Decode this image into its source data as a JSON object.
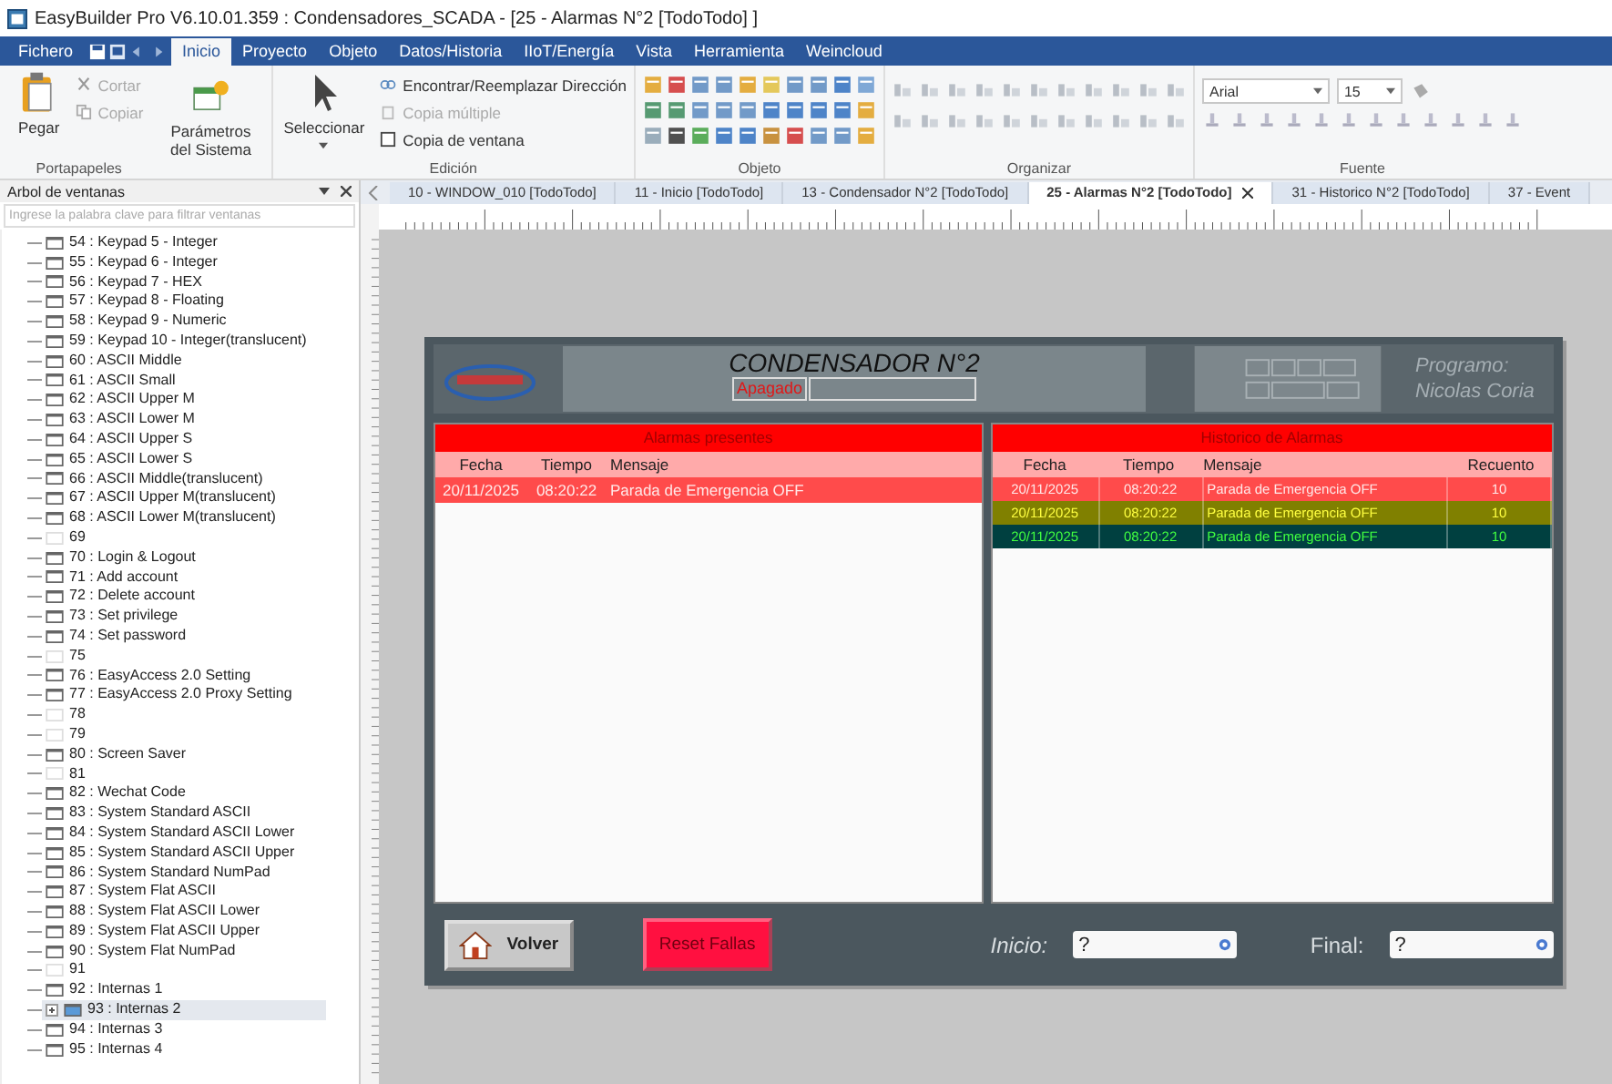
{
  "window": {
    "title": "EasyBuilder Pro V6.10.01.359 : Condensadores_SCADA - [25 - Alarmas N°2 [TodoTodo] ]"
  },
  "menu_tabs": [
    {
      "label": "Fichero",
      "selected": false
    },
    {
      "label": "Inicio",
      "selected": true
    },
    {
      "label": "Proyecto",
      "selected": false
    },
    {
      "label": "Objeto",
      "selected": false
    },
    {
      "label": "Datos/Historia",
      "selected": false
    },
    {
      "label": "IIoT/Energía",
      "selected": false
    },
    {
      "label": "Vista",
      "selected": false
    },
    {
      "label": "Herramienta",
      "selected": false
    },
    {
      "label": "Weincloud",
      "selected": false
    }
  ],
  "ribbon": {
    "clipboard": {
      "paste": "Pegar",
      "cut": {
        "label": "Cortar",
        "disabled": true
      },
      "copy": {
        "label": "Copiar",
        "disabled": true
      },
      "caption": "Portapapeles"
    },
    "system": {
      "label": "Parámetros del Sistema"
    },
    "edit": {
      "select": "Seleccionar",
      "find": {
        "label": "Encontrar/Reemplazar Dirección",
        "disabled": false
      },
      "multi_copy": {
        "label": "Copia múltiple",
        "disabled": true
      },
      "window_copy": {
        "label": "Copia de ventana",
        "disabled": false
      },
      "caption": "Edición"
    },
    "object": {
      "caption": "Objeto"
    },
    "arrange": {
      "caption": "Organizar"
    },
    "font": {
      "family": "Arial",
      "size": "15",
      "caption": "Fuente"
    }
  },
  "window_tree": {
    "title": "Arbol de ventanas",
    "search": {
      "placeholder": "Ingrese la palabra clave para filtrar ventanas"
    },
    "items": [
      {
        "label": "54 : Keypad 5 - Integer",
        "has_window": true,
        "selected": false,
        "has_children": false
      },
      {
        "label": "55 : Keypad 6 - Integer",
        "has_window": true,
        "selected": false,
        "has_children": false
      },
      {
        "label": "56 : Keypad 7 - HEX",
        "has_window": true,
        "selected": false,
        "has_children": false
      },
      {
        "label": "57 : Keypad 8 - Floating",
        "has_window": true,
        "selected": false,
        "has_children": false
      },
      {
        "label": "58 : Keypad 9 - Numeric",
        "has_window": true,
        "selected": false,
        "has_children": false
      },
      {
        "label": "59 : Keypad 10 - Integer(translucent)",
        "has_window": true,
        "selected": false,
        "has_children": false
      },
      {
        "label": "60 : ASCII Middle",
        "has_window": true,
        "selected": false,
        "has_children": false
      },
      {
        "label": "61 : ASCII Small",
        "has_window": true,
        "selected": false,
        "has_children": false
      },
      {
        "label": "62 : ASCII Upper M",
        "has_window": true,
        "selected": false,
        "has_children": false
      },
      {
        "label": "63 : ASCII Lower M",
        "has_window": true,
        "selected": false,
        "has_children": false
      },
      {
        "label": "64 : ASCII Upper S",
        "has_window": true,
        "selected": false,
        "has_children": false
      },
      {
        "label": "65 : ASCII Lower S",
        "has_window": true,
        "selected": false,
        "has_children": false
      },
      {
        "label": "66 : ASCII Middle(translucent)",
        "has_window": true,
        "selected": false,
        "has_children": false
      },
      {
        "label": "67 : ASCII Upper M(translucent)",
        "has_window": true,
        "selected": false,
        "has_children": false
      },
      {
        "label": "68 : ASCII Lower M(translucent)",
        "has_window": true,
        "selected": false,
        "has_children": false
      },
      {
        "label": "69",
        "has_window": false,
        "selected": false,
        "has_children": false
      },
      {
        "label": "70 : Login & Logout",
        "has_window": true,
        "selected": false,
        "has_children": false
      },
      {
        "label": "71 : Add account",
        "has_window": true,
        "selected": false,
        "has_children": false
      },
      {
        "label": "72 : Delete account",
        "has_window": true,
        "selected": false,
        "has_children": false
      },
      {
        "label": "73 : Set privilege",
        "has_window": true,
        "selected": false,
        "has_children": false
      },
      {
        "label": "74 : Set password",
        "has_window": true,
        "selected": false,
        "has_children": false
      },
      {
        "label": "75",
        "has_window": false,
        "selected": false,
        "has_children": false
      },
      {
        "label": "76 : EasyAccess 2.0 Setting",
        "has_window": true,
        "selected": false,
        "has_children": false
      },
      {
        "label": "77 : EasyAccess 2.0 Proxy Setting",
        "has_window": true,
        "selected": false,
        "has_children": false
      },
      {
        "label": "78",
        "has_window": false,
        "selected": false,
        "has_children": false
      },
      {
        "label": "79",
        "has_window": false,
        "selected": false,
        "has_children": false
      },
      {
        "label": "80 : Screen Saver",
        "has_window": true,
        "selected": false,
        "has_children": false
      },
      {
        "label": "81",
        "has_window": false,
        "selected": false,
        "has_children": false
      },
      {
        "label": "82 : Wechat Code",
        "has_window": true,
        "selected": false,
        "has_children": false
      },
      {
        "label": "83 : System Standard ASCII",
        "has_window": true,
        "selected": false,
        "has_children": false
      },
      {
        "label": "84 : System Standard ASCII Lower",
        "has_window": true,
        "selected": false,
        "has_children": false
      },
      {
        "label": "85 : System Standard ASCII Upper",
        "has_window": true,
        "selected": false,
        "has_children": false
      },
      {
        "label": "86 : System Standard NumPad",
        "has_window": true,
        "selected": false,
        "has_children": false
      },
      {
        "label": "87 : System Flat ASCII",
        "has_window": true,
        "selected": false,
        "has_children": false
      },
      {
        "label": "88 : System Flat ASCII Lower",
        "has_window": true,
        "selected": false,
        "has_children": false
      },
      {
        "label": "89 : System Flat ASCII Upper",
        "has_window": true,
        "selected": false,
        "has_children": false
      },
      {
        "label": "90 : System Flat NumPad",
        "has_window": true,
        "selected": false,
        "has_children": false
      },
      {
        "label": "91",
        "has_window": false,
        "selected": false,
        "has_children": false
      },
      {
        "label": "92 : Internas 1",
        "has_window": true,
        "selected": false,
        "has_children": false
      },
      {
        "label": "93 : Internas 2",
        "has_window": true,
        "selected": true,
        "has_children": true
      },
      {
        "label": "94 : Internas 3",
        "has_window": true,
        "selected": false,
        "has_children": false
      },
      {
        "label": "95 : Internas 4",
        "has_window": true,
        "selected": false,
        "has_children": false
      }
    ]
  },
  "doc_tabs": [
    {
      "label": "10 - WINDOW_010 [TodoTodo]",
      "selected": false
    },
    {
      "label": "11 - Inicio [TodoTodo]",
      "selected": false
    },
    {
      "label": "13 - Condensador N°2 [TodoTodo]",
      "selected": false
    },
    {
      "label": "25 - Alarmas N°2 [TodoTodo]",
      "selected": true
    },
    {
      "label": "31 - Historico N°2 [TodoTodo]",
      "selected": false
    },
    {
      "label": "37 - Event",
      "selected": false
    }
  ],
  "screen": {
    "title": "CONDENSADOR N°2",
    "status": "Apagado",
    "author_label": "Programo:",
    "author": "Nicolas Coria",
    "present_alarms": {
      "title": "Alarmas presentes",
      "columns": [
        "Fecha",
        "Tiempo",
        "Mensaje"
      ],
      "rows": [
        {
          "cells": [
            "20/11/2025",
            "08:20:22",
            "Parada de Emergencia OFF"
          ],
          "color": "#ff4b4b",
          "kind": "active"
        }
      ]
    },
    "alarm_history": {
      "title": "Historico de Alarmas",
      "columns": [
        "Fecha",
        "Tiempo",
        "Mensaje",
        "Recuento"
      ],
      "rows": [
        {
          "cells": [
            "20/11/2025",
            "08:20:22",
            "Parada de Emergencia OFF",
            "10"
          ],
          "color": "#ff4b4b",
          "kind": "active"
        },
        {
          "cells": [
            "20/11/2025",
            "08:20:22",
            "Parada de Emergencia OFF",
            "10"
          ],
          "color": "#808000",
          "kind": "acknowledged"
        },
        {
          "cells": [
            "20/11/2025",
            "08:20:22",
            "Parada de Emergencia OFF",
            "10"
          ],
          "color": "#004040",
          "kind": "recovered"
        }
      ]
    },
    "back_button": "Volver",
    "reset_button": "Reset Fallas",
    "start": {
      "label": "Inicio:",
      "value": "?"
    },
    "end": {
      "label": "Final:",
      "value": "?"
    }
  }
}
